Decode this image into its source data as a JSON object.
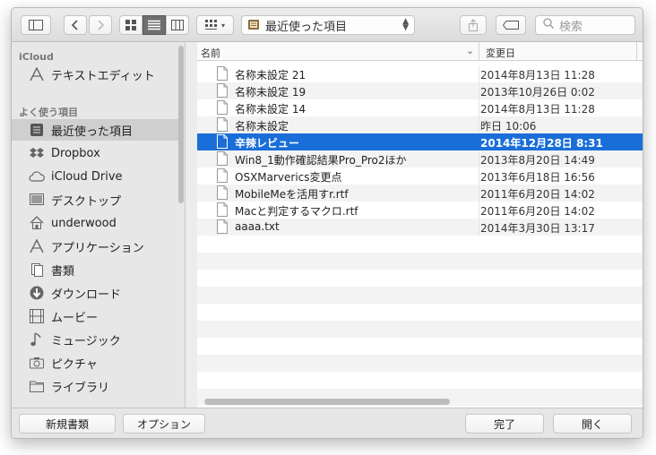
{
  "toolbar": {
    "location": "最近使った項目",
    "search_placeholder": "検索"
  },
  "sidebar": {
    "icloud_header": "iCloud",
    "icloud_items": [
      {
        "label": "テキストエディット",
        "icon": "textedit-icon"
      }
    ],
    "favorites_header": "よく使う項目",
    "favorites": [
      {
        "label": "最近使った項目",
        "icon": "recents-icon",
        "selected": true
      },
      {
        "label": "Dropbox",
        "icon": "dropbox-icon"
      },
      {
        "label": "iCloud Drive",
        "icon": "cloud-icon"
      },
      {
        "label": "デスクトップ",
        "icon": "desktop-icon"
      },
      {
        "label": "underwood",
        "icon": "home-icon"
      },
      {
        "label": "アプリケーション",
        "icon": "applications-icon"
      },
      {
        "label": "書類",
        "icon": "documents-icon"
      },
      {
        "label": "ダウンロード",
        "icon": "downloads-icon"
      },
      {
        "label": "ムービー",
        "icon": "movies-icon"
      },
      {
        "label": "ミュージック",
        "icon": "music-icon"
      },
      {
        "label": "ピクチャ",
        "icon": "camera-icon"
      },
      {
        "label": "ライブラリ",
        "icon": "folder-icon"
      }
    ]
  },
  "columns": {
    "name": "名前",
    "date": "変更日"
  },
  "files": [
    {
      "name": "名称未設定 21",
      "date": "2014年8月13日 11:28"
    },
    {
      "name": "名称未設定 19",
      "date": "2013年10月26日 0:02"
    },
    {
      "name": "名称未設定 14",
      "date": "2014年8月13日 11:28"
    },
    {
      "name": "名称未設定",
      "date": "昨日 10:06"
    },
    {
      "name": "辛辣レビュー",
      "date": "2014年12月28日 8:31",
      "selected": true
    },
    {
      "name": "Win8_1動作確認結果Pro_Pro2ほか",
      "date": "2013年8月20日 14:49"
    },
    {
      "name": "OSXMarverics変更点",
      "date": "2013年6月18日 16:56"
    },
    {
      "name": "MobileMeを活用すr.rtf",
      "date": "2011年6月20日 14:02"
    },
    {
      "name": "Macと判定するマクロ.rtf",
      "date": "2011年6月20日 14:02"
    },
    {
      "name": "aaaa.txt",
      "date": "2014年3月30日 13:17"
    }
  ],
  "bottom": {
    "new_document": "新規書類",
    "options": "オプション",
    "done": "完了",
    "open": "開く"
  },
  "colors": {
    "selection": "#1a6ed8",
    "sidebar_selection": "#cfcfcf"
  }
}
